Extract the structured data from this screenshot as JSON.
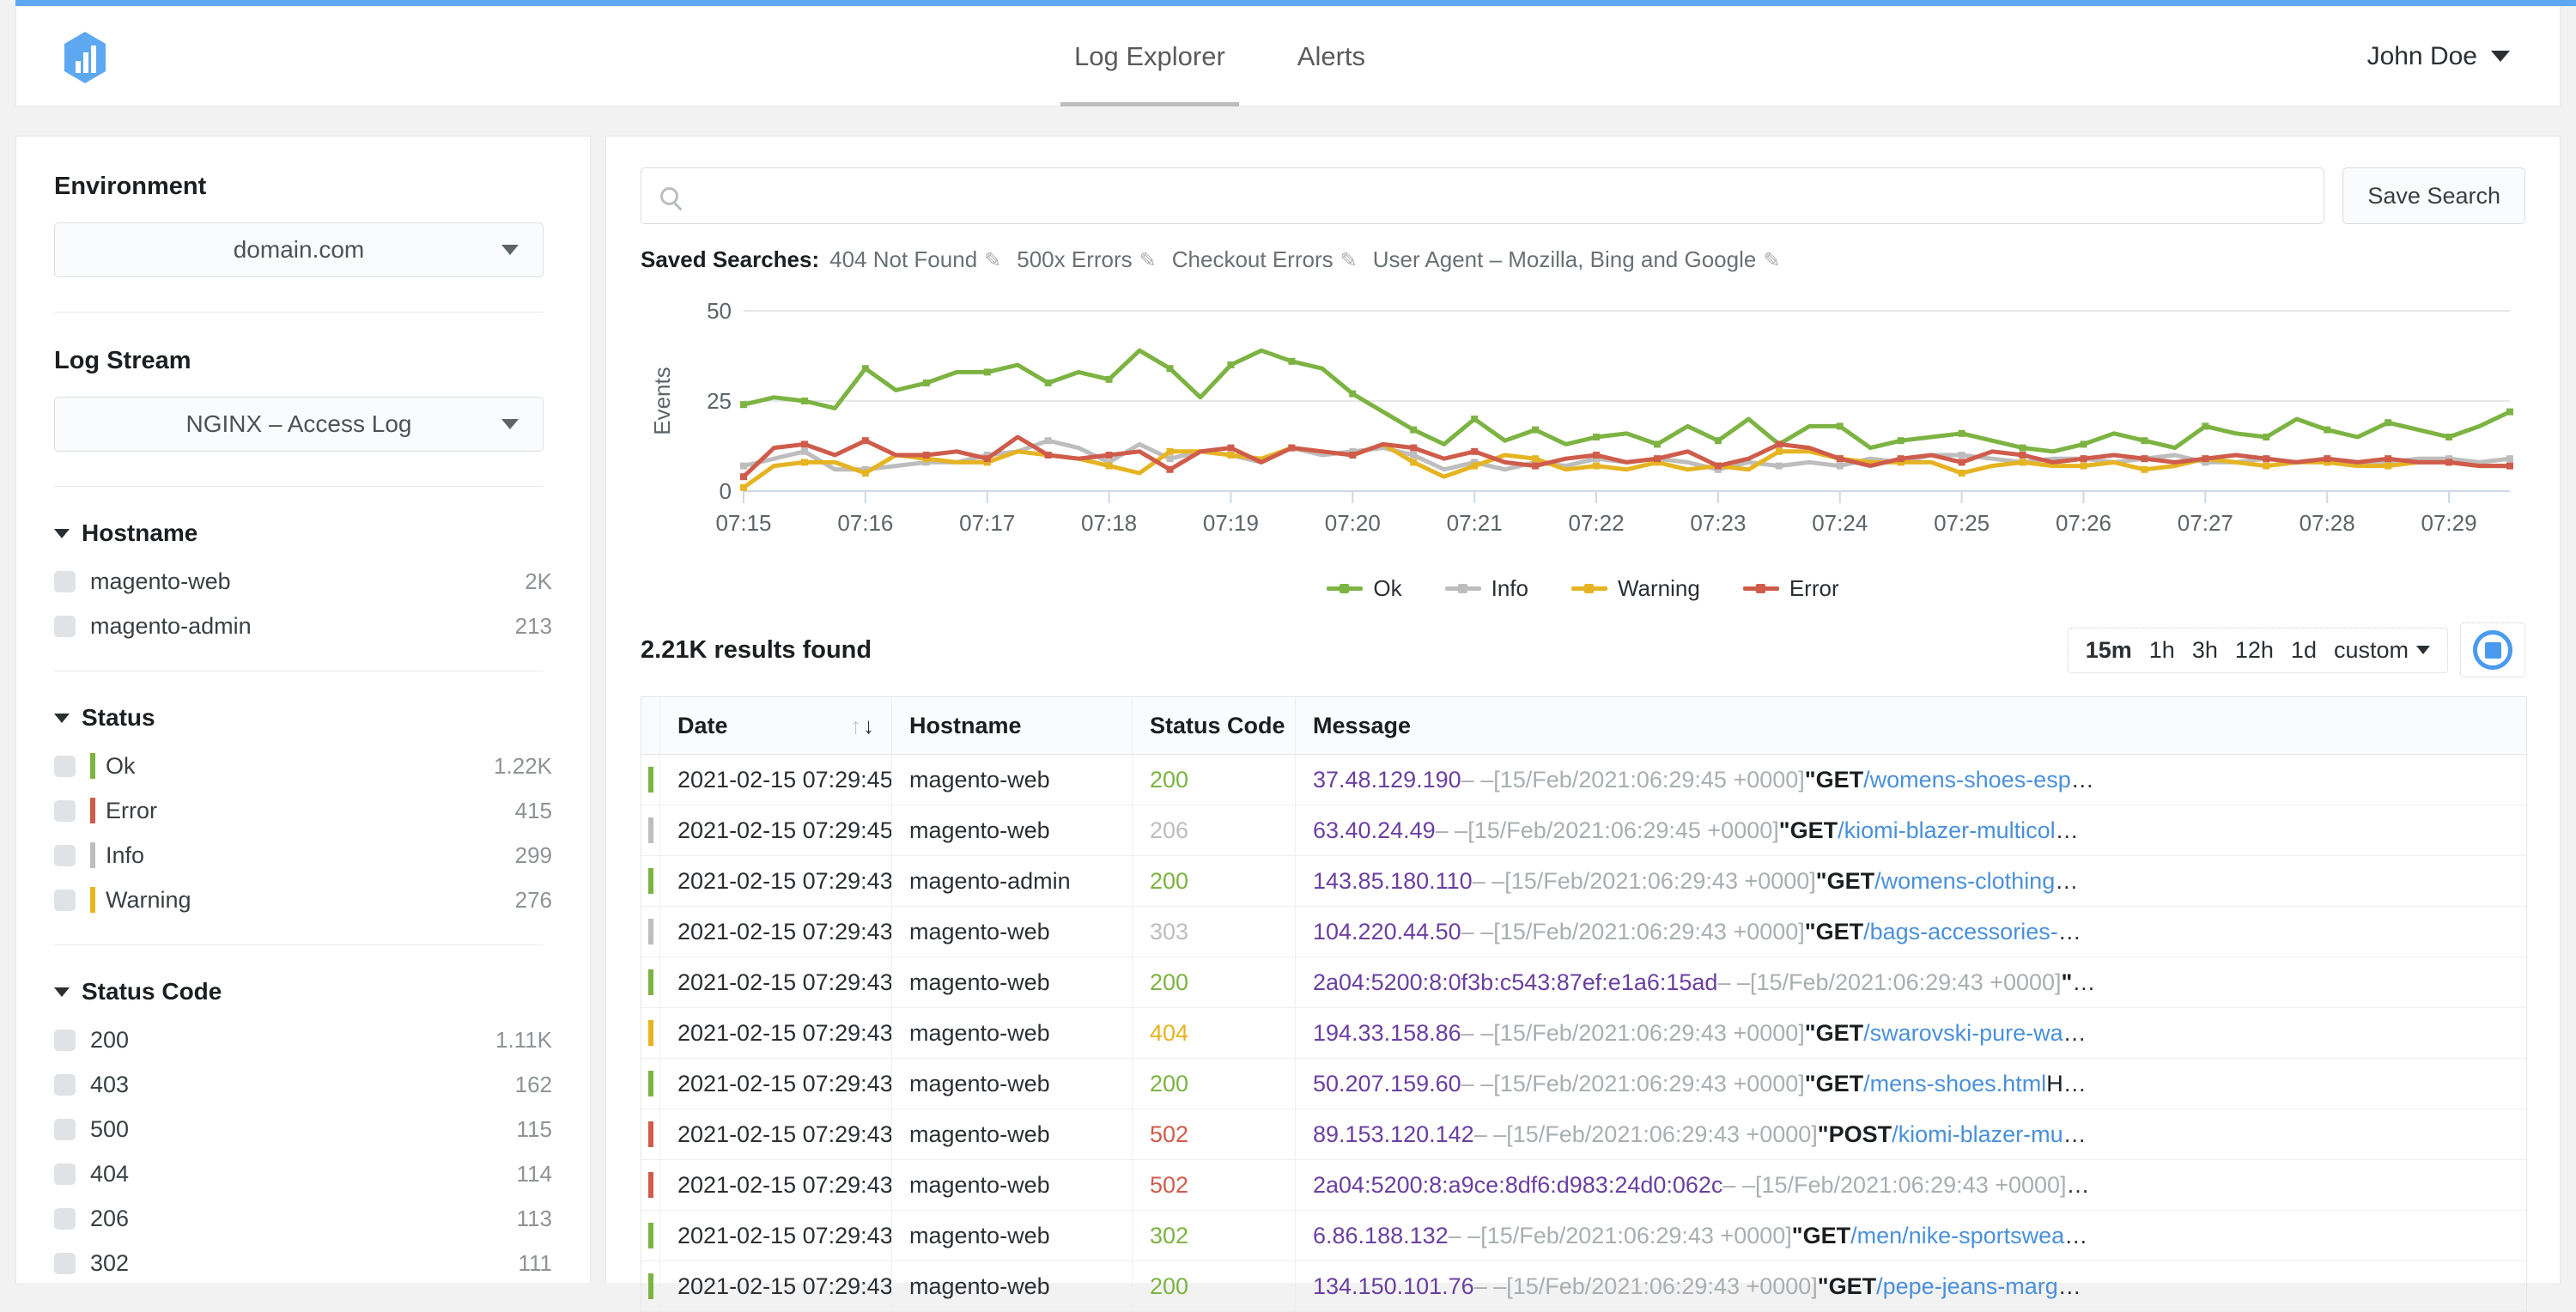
{
  "theme": {
    "accent": "#5da8f0",
    "ok": "#7cb342",
    "info": "#bdbdbd",
    "warning": "#e6b422",
    "error": "#cf5c4b",
    "ip": "#6b3fa0",
    "path": "#4a90d9"
  },
  "header": {
    "logo_icon": "bar-chart-hexagon-logo",
    "nav": [
      {
        "label": "Log Explorer",
        "active": true
      },
      {
        "label": "Alerts",
        "active": false
      }
    ],
    "user": {
      "name": "John Doe",
      "caret_icon": "chevron-down-icon"
    }
  },
  "sidebar": {
    "environment": {
      "title": "Environment",
      "selected": "domain.com",
      "caret_icon": "chevron-down-icon"
    },
    "log_stream": {
      "title": "Log Stream",
      "selected": "NGINX – Access Log",
      "caret_icon": "chevron-down-icon"
    },
    "facets": [
      {
        "title": "Hostname",
        "toggle_icon": "triangle-down-icon",
        "rows": [
          {
            "label": "magento-web",
            "count": "2K",
            "color": null
          },
          {
            "label": "magento-admin",
            "count": "213",
            "color": null
          }
        ]
      },
      {
        "title": "Status",
        "toggle_icon": "triangle-down-icon",
        "rows": [
          {
            "label": "Ok",
            "count": "1.22K",
            "color": "#7cb342"
          },
          {
            "label": "Error",
            "count": "415",
            "color": "#cf5c4b"
          },
          {
            "label": "Info",
            "count": "299",
            "color": "#bdbdbd"
          },
          {
            "label": "Warning",
            "count": "276",
            "color": "#e6b422"
          }
        ]
      },
      {
        "title": "Status Code",
        "toggle_icon": "triangle-down-icon",
        "rows": [
          {
            "label": "200",
            "count": "1.11K",
            "color": null
          },
          {
            "label": "403",
            "count": "162",
            "color": null
          },
          {
            "label": "500",
            "count": "115",
            "color": null
          },
          {
            "label": "404",
            "count": "114",
            "color": null
          },
          {
            "label": "206",
            "count": "113",
            "color": null
          },
          {
            "label": "302",
            "count": "111",
            "color": null
          }
        ]
      }
    ]
  },
  "search": {
    "value": "",
    "placeholder": "",
    "icon": "search-icon",
    "save_button": "Save Search"
  },
  "saved_searches": {
    "label": "Saved Searches:",
    "edit_icon": "pencil-icon",
    "items": [
      "404 Not Found",
      "500x Errors",
      "Checkout Errors",
      "User Agent – Mozilla, Bing and Google"
    ]
  },
  "results": {
    "count_text": "2.21K results found",
    "ranges": [
      {
        "label": "15m",
        "active": true
      },
      {
        "label": "1h",
        "active": false
      },
      {
        "label": "3h",
        "active": false
      },
      {
        "label": "12h",
        "active": false
      },
      {
        "label": "1d",
        "active": false
      },
      {
        "label": "custom",
        "active": false
      }
    ],
    "live_button_icon": "stop-circle-icon"
  },
  "table": {
    "columns": [
      "Date",
      "Hostname",
      "Status Code",
      "Message"
    ],
    "sort": {
      "column": "Date",
      "direction": "desc",
      "icon": "sort-arrows-icon"
    },
    "rows": [
      {
        "date": "2021-02-15 07:29:45",
        "hostname": "magento-web",
        "code": "200",
        "status": "ok",
        "msg": {
          "ip": "37.48.129.190",
          "dashes": "– –",
          "ts": "[15/Feb/2021:06:29:45 +0000]",
          "quote": "\"",
          "verb": "GET",
          "path": "/womens-shoes-esp",
          "tail": "",
          "ellipsis": "…"
        }
      },
      {
        "date": "2021-02-15 07:29:45",
        "hostname": "magento-web",
        "code": "206",
        "status": "info",
        "msg": {
          "ip": "63.40.24.49",
          "dashes": "– –",
          "ts": "[15/Feb/2021:06:29:45 +0000]",
          "quote": "\"",
          "verb": "GET",
          "path": "/kiomi-blazer-multicol",
          "tail": "",
          "ellipsis": "…"
        }
      },
      {
        "date": "2021-02-15 07:29:43",
        "hostname": "magento-admin",
        "code": "200",
        "status": "ok",
        "msg": {
          "ip": "143.85.180.110",
          "dashes": "– –",
          "ts": "[15/Feb/2021:06:29:43 +0000]",
          "quote": "\"",
          "verb": "GET",
          "path": "/womens-clothing",
          "tail": "",
          "ellipsis": "…"
        }
      },
      {
        "date": "2021-02-15 07:29:43",
        "hostname": "magento-web",
        "code": "303",
        "status": "info",
        "msg": {
          "ip": "104.220.44.50",
          "dashes": "– –",
          "ts": "[15/Feb/2021:06:29:43 +0000]",
          "quote": "\"",
          "verb": "GET",
          "path": "/bags-accessories-",
          "tail": "",
          "ellipsis": "…"
        }
      },
      {
        "date": "2021-02-15 07:29:43",
        "hostname": "magento-web",
        "code": "200",
        "status": "ok",
        "msg": {
          "ip": "2a04:5200:8:0f3b:c543:87ef:e1a6:15ad",
          "dashes": "– –",
          "ts": "[15/Feb/2021:06:29:43 +0000]",
          "quote": "\"",
          "verb": "",
          "path": "",
          "tail": "",
          "ellipsis": "…"
        }
      },
      {
        "date": "2021-02-15 07:29:43",
        "hostname": "magento-web",
        "code": "404",
        "status": "warning",
        "msg": {
          "ip": "194.33.158.86",
          "dashes": "– –",
          "ts": "[15/Feb/2021:06:29:43 +0000]",
          "quote": "\"",
          "verb": "GET",
          "path": "/swarovski-pure-wa",
          "tail": "",
          "ellipsis": "…"
        }
      },
      {
        "date": "2021-02-15 07:29:43",
        "hostname": "magento-web",
        "code": "200",
        "status": "ok",
        "msg": {
          "ip": "50.207.159.60",
          "dashes": "– –",
          "ts": "[15/Feb/2021:06:29:43 +0000]",
          "quote": "\"",
          "verb": "GET",
          "path": "/mens-shoes.html",
          "tail": "H",
          "ellipsis": "…"
        }
      },
      {
        "date": "2021-02-15 07:29:43",
        "hostname": "magento-web",
        "code": "502",
        "status": "error",
        "msg": {
          "ip": "89.153.120.142",
          "dashes": "– –",
          "ts": "[15/Feb/2021:06:29:43 +0000]",
          "quote": "\"",
          "verb": "POST",
          "path": "/kiomi-blazer-mu",
          "tail": "",
          "ellipsis": "…"
        }
      },
      {
        "date": "2021-02-15 07:29:43",
        "hostname": "magento-web",
        "code": "502",
        "status": "error",
        "msg": {
          "ip": "2a04:5200:8:a9ce:8df6:d983:24d0:062c",
          "dashes": "– –",
          "ts": "[15/Feb/2021:06:29:43 +0000]",
          "quote": "",
          "verb": "",
          "path": "",
          "tail": "",
          "ellipsis": "…"
        }
      },
      {
        "date": "2021-02-15 07:29:43",
        "hostname": "magento-web",
        "code": "302",
        "status": "ok",
        "msg": {
          "ip": "6.86.188.132",
          "dashes": "– –",
          "ts": "[15/Feb/2021:06:29:43 +0000]",
          "quote": "\"",
          "verb": "GET",
          "path": "/men/nike-sportswea",
          "tail": "",
          "ellipsis": "…"
        }
      },
      {
        "date": "2021-02-15 07:29:43",
        "hostname": "magento-web",
        "code": "200",
        "status": "ok",
        "msg": {
          "ip": "134.150.101.76",
          "dashes": "– –",
          "ts": "[15/Feb/2021:06:29:43 +0000]",
          "quote": "\"",
          "verb": "GET",
          "path": "/pepe-jeans-marg",
          "tail": "",
          "ellipsis": "…"
        }
      }
    ]
  },
  "chart_data": {
    "type": "line",
    "title": "",
    "xlabel": "",
    "ylabel": "Events",
    "ylim": [
      0,
      50
    ],
    "yticks": [
      0,
      25,
      50
    ],
    "grid": true,
    "legend_position": "bottom",
    "xticks": [
      "07:15",
      "07:16",
      "07:17",
      "07:18",
      "07:19",
      "07:20",
      "07:21",
      "07:22",
      "07:23",
      "07:24",
      "07:25",
      "07:26",
      "07:27",
      "07:28",
      "07:29"
    ],
    "series": [
      {
        "name": "Ok",
        "color": "#7cb342",
        "values": [
          24,
          26,
          25,
          23,
          34,
          28,
          30,
          33,
          33,
          35,
          30,
          33,
          31,
          39,
          34,
          26,
          35,
          39,
          36,
          34,
          27,
          22,
          17,
          13,
          20,
          14,
          17,
          13,
          15,
          16,
          13,
          18,
          14,
          20,
          13,
          18,
          18,
          12,
          14,
          15,
          16,
          14,
          12,
          11,
          13,
          16,
          14,
          12,
          18,
          16,
          15,
          20,
          17,
          15,
          19,
          17,
          15,
          18,
          22
        ]
      },
      {
        "name": "Info",
        "color": "#bdbdbd",
        "values": [
          7,
          9,
          11,
          6,
          6,
          7,
          8,
          8,
          10,
          11,
          14,
          12,
          8,
          13,
          9,
          11,
          10,
          8,
          12,
          10,
          11,
          12,
          10,
          6,
          8,
          6,
          8,
          7,
          9,
          8,
          9,
          8,
          6,
          8,
          7,
          8,
          7,
          9,
          8,
          10,
          10,
          9,
          8,
          9,
          9,
          8,
          9,
          10,
          8,
          8,
          9,
          8,
          9,
          8,
          8,
          9,
          9,
          8,
          9
        ]
      },
      {
        "name": "Warning",
        "color": "#e6b422",
        "values": [
          1,
          7,
          8,
          8,
          5,
          10,
          9,
          8,
          8,
          11,
          10,
          9,
          7,
          5,
          11,
          11,
          10,
          9,
          12,
          11,
          10,
          13,
          8,
          4,
          7,
          10,
          9,
          6,
          7,
          6,
          8,
          6,
          7,
          6,
          11,
          11,
          9,
          8,
          8,
          8,
          5,
          7,
          8,
          7,
          7,
          8,
          6,
          7,
          9,
          8,
          7,
          8,
          8,
          7,
          7,
          8,
          8,
          7,
          7
        ]
      },
      {
        "name": "Error",
        "color": "#cf5c4b",
        "values": [
          4,
          12,
          13,
          10,
          14,
          10,
          10,
          11,
          9,
          15,
          10,
          9,
          10,
          11,
          6,
          11,
          12,
          8,
          12,
          11,
          10,
          13,
          12,
          9,
          11,
          8,
          7,
          9,
          10,
          8,
          9,
          11,
          7,
          9,
          13,
          12,
          9,
          7,
          9,
          10,
          8,
          11,
          10,
          8,
          9,
          10,
          9,
          8,
          9,
          10,
          9,
          8,
          9,
          8,
          9,
          8,
          8,
          7,
          7
        ]
      }
    ]
  }
}
